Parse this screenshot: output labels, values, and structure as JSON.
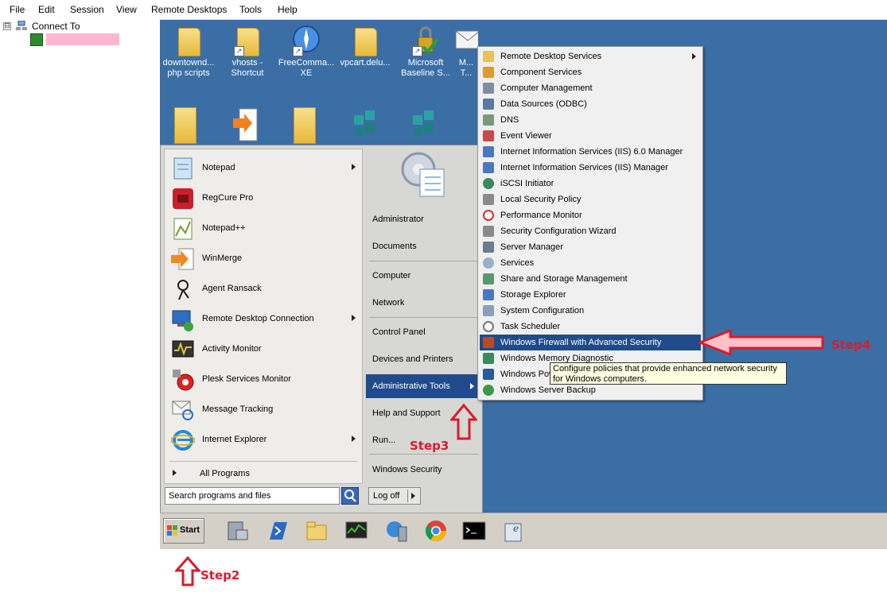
{
  "menubar": {
    "items": [
      "File",
      "Edit",
      "Session",
      "View",
      "Remote Desktops",
      "Tools",
      "Help"
    ]
  },
  "tree": {
    "toggle": "⊟",
    "root": "Connect To"
  },
  "desktop": {
    "icons_row1": [
      "downtownd... php scripts",
      "vhosts - Shortcut",
      "FreeComma... XE",
      "vpcart.delu...",
      "Microsoft Baseline S...",
      "M... T..."
    ]
  },
  "startmenu": {
    "programs": [
      "Notepad",
      "RegCure Pro",
      "Notepad++",
      "WinMerge",
      "Agent Ransack",
      "Remote Desktop Connection",
      "Activity Monitor",
      "Plesk Services Monitor",
      "Message Tracking",
      "Internet Explorer"
    ],
    "all_programs": "All Programs",
    "right": [
      "Administrator",
      "Documents",
      "Computer",
      "Network",
      "Control Panel",
      "Devices and Printers",
      "Administrative Tools",
      "Help and Support",
      "Run...",
      "Windows Security"
    ],
    "search_placeholder": "Search programs and files",
    "logoff": "Log off"
  },
  "admin_tools": [
    "Remote Desktop Services",
    "Component Services",
    "Computer Management",
    "Data Sources (ODBC)",
    "DNS",
    "Event Viewer",
    "Internet Information Services (IIS) 6.0 Manager",
    "Internet Information Services (IIS) Manager",
    "iSCSI Initiator",
    "Local Security Policy",
    "Performance Monitor",
    "Security Configuration Wizard",
    "Server Manager",
    "Services",
    "Share and Storage Management",
    "Storage Explorer",
    "System Configuration",
    "Task Scheduler",
    "Windows Firewall with Advanced Security",
    "Windows Memory Diagnostic",
    "Windows PowerShell Modules",
    "Windows Server Backup"
  ],
  "tooltip": "Configure policies that provide enhanced network security for Windows computers.",
  "taskbar": {
    "start": "Start"
  },
  "steps": {
    "step2": "Step2",
    "step3": "Step3",
    "step4": "Step4"
  },
  "colors": {
    "desktop": "#3b6ea5",
    "highlight": "#1f4b8c",
    "arrow": "#d81c2c"
  }
}
